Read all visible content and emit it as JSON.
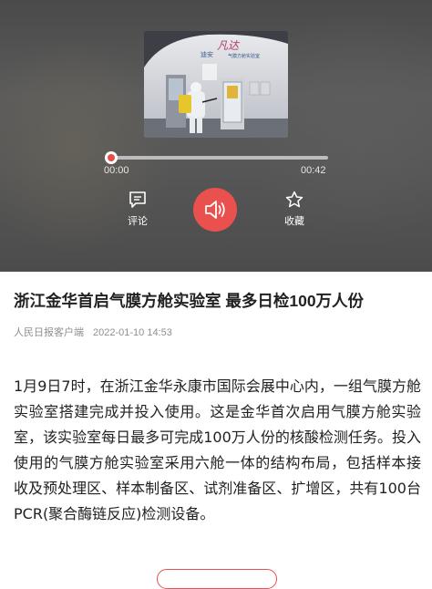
{
  "player": {
    "thumbnail": {
      "sign_line1": "迪安",
      "sign_line2": "气膜方舱实验室",
      "sign_brand": "凡达"
    },
    "current_time": "00:00",
    "total_time": "00:42",
    "progress": 0.0,
    "comment_label": "评论",
    "favorite_label": "收藏",
    "accent_color": "#e9504e"
  },
  "article": {
    "title": "浙江金华首启气膜方舱实验室 最多日检100万人份",
    "source": "人民日报客户端",
    "date": "2022-01-10 14:53",
    "body": "1月9日7时，在浙江金华永康市国际会展中心内，一组气膜方舱实验室搭建完成并投入使用。这是金华首次启用气膜方舱实验室，该实验室每日最多可完成100万人份的核酸检测任务。投入使用的气膜方舱实验室采用六舱一体的结构布局，包括样本接收及预处理区、样本制备区、试剂准备区、扩增区，共有100台PCR(聚合酶链反应)检测设备。"
  }
}
